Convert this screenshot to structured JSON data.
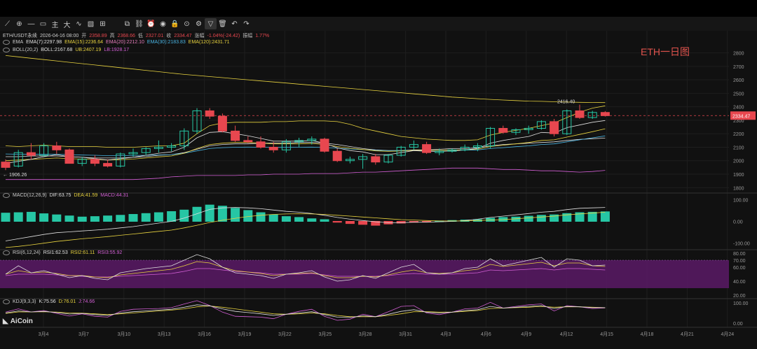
{
  "toolbar": {
    "icons": [
      "draw-line-icon",
      "cursor-icon",
      "horizontal-line-icon",
      "rectangle-icon",
      "text-icon",
      "fibonacci-icon",
      "pattern-icon",
      "brush-icon",
      "measure-icon",
      "copy-icon",
      "link-icon",
      "alert-icon",
      "eye-icon",
      "lock-icon",
      "magnet-icon",
      "settings-icon",
      "filter-icon",
      "trash-icon",
      "undo-icon",
      "redo-icon"
    ],
    "glyphs": [
      "⟋",
      "⊕",
      "—",
      "▭",
      "主",
      "大",
      "∿",
      "▧",
      "⊞",
      "⧉",
      "⛓",
      "⏰",
      "◉",
      "🔒",
      "⊙",
      "⚙",
      "▽",
      "🗑",
      "↶",
      "↷"
    ]
  },
  "colors": {
    "up": "#26c6a4",
    "down": "#e8474f",
    "ema7": "#e0e0e0",
    "ema15": "#e8d33f",
    "ema20": "#e67dbb",
    "ema30": "#4ab5e3",
    "ema120": "#e8d33f",
    "boll": "#e0e0e0",
    "ub": "#e8d33f",
    "lb": "#d35fd5",
    "dif": "#e0e0e0",
    "dea": "#e8d33f",
    "rsi1": "#e0e0e0",
    "rsi2": "#e8d33f",
    "rsi3": "#d35fd5",
    "watermark": "#e0534d"
  },
  "header": {
    "symbol": "ETH/USDT永续",
    "date": "2026-04-16 08:00",
    "open_label": "开",
    "open": "2358.89",
    "high_label": "高",
    "high": "2368.66",
    "low_label": "低",
    "low": "2327.01",
    "close_label": "收",
    "close": "2334.47",
    "change_label": "涨幅",
    "change": "-1.04%(-24.42)",
    "amp_label": "振幅",
    "amp": "1.77%"
  },
  "ema_legend": {
    "name": "EMA",
    "ema7": "EMA(7):2297.98",
    "ema15": "EMA(15):2236.64",
    "ema20": "EMA(20):2212.10",
    "ema30": "EMA(30):2183.83",
    "ema120": "EMA(120):2431.71"
  },
  "boll_legend": {
    "name": "BOLL(20,2)",
    "boll": "BOLL:2167.68",
    "ub": "UB:2407.19",
    "lb": "LB:1928.17"
  },
  "macd_legend": {
    "name": "MACD(12,26,9)",
    "dif": "DIF:63.75",
    "dea": "DEA:41.59",
    "macd": "MACD:44.31"
  },
  "rsi_legend": {
    "name": "RSI(6,12,24)",
    "rsi1": "RSI1:62.53",
    "rsi2": "RSI2:61.11",
    "rsi3": "RSI3:55.92"
  },
  "kdj_legend": {
    "name": "KDJ(9,3,3)",
    "k": "K:75.56",
    "d": "D:76.01",
    "j": "J:74.66"
  },
  "watermark": "ETH一日图",
  "logo": "AiCoin",
  "annotations": {
    "high_label": "2416.40",
    "low_label": "1906.26",
    "current_price": "2334.47"
  },
  "chart_data": {
    "type": "candlestick",
    "price_axis": {
      "ticks": [
        1800,
        1900,
        2000,
        2100,
        2200,
        2300,
        2400,
        2500,
        2600,
        2700,
        2800
      ],
      "range": [
        1760,
        2860
      ]
    },
    "macd_axis": {
      "ticks": [
        100,
        0,
        -100
      ],
      "range": [
        -130,
        130
      ]
    },
    "rsi_axis": {
      "ticks": [
        80,
        70,
        60,
        40,
        20
      ],
      "range": [
        15,
        85
      ]
    },
    "kdj_axis": {
      "ticks": [
        100,
        0
      ],
      "range": [
        -20,
        120
      ]
    },
    "x_ticks": [
      "3月4",
      "3月7",
      "3月10",
      "3月13",
      "3月16",
      "3月19",
      "3月22",
      "3月25",
      "3月28",
      "3月31",
      "4月3",
      "4月6",
      "4月9",
      "4月12",
      "4月15",
      "4月18",
      "4月21",
      "4月24"
    ],
    "candles": [
      {
        "o": 1990,
        "h": 2010,
        "l": 1930,
        "c": 1950
      },
      {
        "o": 1960,
        "h": 2080,
        "l": 1950,
        "c": 2060
      },
      {
        "o": 2060,
        "h": 2130,
        "l": 2010,
        "c": 2040
      },
      {
        "o": 2040,
        "h": 2130,
        "l": 2030,
        "c": 2110
      },
      {
        "o": 2110,
        "h": 2140,
        "l": 2050,
        "c": 2080
      },
      {
        "o": 2080,
        "h": 2090,
        "l": 1990,
        "c": 1980
      },
      {
        "o": 1980,
        "h": 2030,
        "l": 1960,
        "c": 2010
      },
      {
        "o": 2010,
        "h": 2040,
        "l": 1960,
        "c": 1980
      },
      {
        "o": 1980,
        "h": 2010,
        "l": 1950,
        "c": 1960
      },
      {
        "o": 1960,
        "h": 2060,
        "l": 1950,
        "c": 2050
      },
      {
        "o": 2050,
        "h": 2090,
        "l": 2030,
        "c": 2060
      },
      {
        "o": 2060,
        "h": 2100,
        "l": 2040,
        "c": 2090
      },
      {
        "o": 2090,
        "h": 2150,
        "l": 2060,
        "c": 2100
      },
      {
        "o": 2100,
        "h": 2130,
        "l": 2070,
        "c": 2110
      },
      {
        "o": 2110,
        "h": 2240,
        "l": 2080,
        "c": 2220
      },
      {
        "o": 2220,
        "h": 2390,
        "l": 2200,
        "c": 2370
      },
      {
        "o": 2370,
        "h": 2390,
        "l": 2310,
        "c": 2330
      },
      {
        "o": 2330,
        "h": 2350,
        "l": 2210,
        "c": 2220
      },
      {
        "o": 2220,
        "h": 2260,
        "l": 2140,
        "c": 2150
      },
      {
        "o": 2150,
        "h": 2180,
        "l": 2130,
        "c": 2140
      },
      {
        "o": 2140,
        "h": 2180,
        "l": 2090,
        "c": 2100
      },
      {
        "o": 2100,
        "h": 2140,
        "l": 2060,
        "c": 2080
      },
      {
        "o": 2080,
        "h": 2160,
        "l": 2060,
        "c": 2140
      },
      {
        "o": 2140,
        "h": 2170,
        "l": 2100,
        "c": 2150
      },
      {
        "o": 2150,
        "h": 2180,
        "l": 2120,
        "c": 2160
      },
      {
        "o": 2160,
        "h": 2170,
        "l": 2060,
        "c": 2070
      },
      {
        "o": 2070,
        "h": 2090,
        "l": 1990,
        "c": 2000
      },
      {
        "o": 2000,
        "h": 2030,
        "l": 1980,
        "c": 2010
      },
      {
        "o": 2010,
        "h": 2050,
        "l": 1940,
        "c": 2030
      },
      {
        "o": 2030,
        "h": 2050,
        "l": 1970,
        "c": 1990
      },
      {
        "o": 1990,
        "h": 2050,
        "l": 1980,
        "c": 2040
      },
      {
        "o": 2040,
        "h": 2110,
        "l": 2030,
        "c": 2100
      },
      {
        "o": 2100,
        "h": 2150,
        "l": 2080,
        "c": 2120
      },
      {
        "o": 2120,
        "h": 2140,
        "l": 2050,
        "c": 2060
      },
      {
        "o": 2060,
        "h": 2090,
        "l": 2040,
        "c": 2070
      },
      {
        "o": 2070,
        "h": 2090,
        "l": 2060,
        "c": 2080
      },
      {
        "o": 2080,
        "h": 2120,
        "l": 2070,
        "c": 2100
      },
      {
        "o": 2100,
        "h": 2130,
        "l": 2070,
        "c": 2110
      },
      {
        "o": 2110,
        "h": 2250,
        "l": 2090,
        "c": 2240
      },
      {
        "o": 2240,
        "h": 2260,
        "l": 2200,
        "c": 2210
      },
      {
        "o": 2210,
        "h": 2240,
        "l": 2190,
        "c": 2230
      },
      {
        "o": 2230,
        "h": 2260,
        "l": 2200,
        "c": 2240
      },
      {
        "o": 2240,
        "h": 2300,
        "l": 2230,
        "c": 2290
      },
      {
        "o": 2290,
        "h": 2310,
        "l": 2180,
        "c": 2200
      },
      {
        "o": 2200,
        "h": 2380,
        "l": 2190,
        "c": 2370
      },
      {
        "o": 2370,
        "h": 2416,
        "l": 2310,
        "c": 2320
      },
      {
        "o": 2320,
        "h": 2370,
        "l": 2310,
        "c": 2358
      },
      {
        "o": 2358,
        "h": 2368,
        "l": 2327,
        "c": 2334
      }
    ],
    "ub": [
      2110,
      2105,
      2110,
      2115,
      2110,
      2105,
      2105,
      2105,
      2100,
      2100,
      2100,
      2105,
      2110,
      2110,
      2130,
      2200,
      2260,
      2280,
      2285,
      2285,
      2285,
      2290,
      2290,
      2295,
      2295,
      2295,
      2290,
      2270,
      2240,
      2220,
      2200,
      2180,
      2170,
      2160,
      2155,
      2150,
      2150,
      2155,
      2190,
      2210,
      2225,
      2240,
      2260,
      2280,
      2320,
      2360,
      2390,
      2407
    ],
    "boll": [
      2030,
      2030,
      2035,
      2035,
      2035,
      2030,
      2025,
      2020,
      2020,
      2020,
      2025,
      2030,
      2040,
      2045,
      2060,
      2085,
      2110,
      2120,
      2125,
      2125,
      2130,
      2130,
      2130,
      2135,
      2135,
      2130,
      2120,
      2105,
      2090,
      2080,
      2075,
      2075,
      2080,
      2080,
      2085,
      2090,
      2090,
      2095,
      2110,
      2120,
      2125,
      2130,
      2135,
      2140,
      2150,
      2158,
      2163,
      2168
    ],
    "lb": [
      1860,
      1860,
      1860,
      1860,
      1860,
      1860,
      1860,
      1860,
      1860,
      1860,
      1860,
      1865,
      1870,
      1880,
      1885,
      1890,
      1890,
      1890,
      1890,
      1895,
      1895,
      1900,
      1900,
      1900,
      1905,
      1905,
      1905,
      1910,
      1915,
      1915,
      1920,
      1925,
      1930,
      1935,
      1940,
      1945,
      1945,
      1945,
      1940,
      1935,
      1935,
      1930,
      1925,
      1925,
      1920,
      1915,
      1920,
      1928
    ],
    "ema7": [
      1980,
      1995,
      2010,
      2030,
      2045,
      2030,
      2025,
      2015,
      2005,
      2015,
      2025,
      2040,
      2055,
      2065,
      2100,
      2170,
      2210,
      2215,
      2200,
      2185,
      2165,
      2145,
      2145,
      2145,
      2150,
      2130,
      2095,
      2075,
      2065,
      2045,
      2045,
      2060,
      2075,
      2070,
      2070,
      2072,
      2080,
      2090,
      2130,
      2150,
      2165,
      2180,
      2210,
      2205,
      2245,
      2265,
      2285,
      2298
    ],
    "ema15": [
      2000,
      2005,
      2010,
      2015,
      2020,
      2015,
      2012,
      2010,
      2005,
      2008,
      2012,
      2020,
      2028,
      2035,
      2055,
      2090,
      2120,
      2130,
      2135,
      2135,
      2130,
      2125,
      2125,
      2125,
      2128,
      2120,
      2105,
      2092,
      2083,
      2073,
      2070,
      2072,
      2077,
      2077,
      2077,
      2078,
      2081,
      2085,
      2105,
      2115,
      2125,
      2135,
      2150,
      2155,
      2175,
      2195,
      2215,
      2237
    ],
    "ema30": [
      2050,
      2048,
      2047,
      2047,
      2047,
      2045,
      2042,
      2040,
      2037,
      2037,
      2038,
      2040,
      2043,
      2045,
      2055,
      2073,
      2090,
      2097,
      2100,
      2101,
      2100,
      2099,
      2099,
      2100,
      2101,
      2098,
      2092,
      2087,
      2082,
      2077,
      2075,
      2075,
      2077,
      2077,
      2077,
      2077,
      2078,
      2080,
      2090,
      2097,
      2104,
      2110,
      2120,
      2125,
      2140,
      2155,
      2170,
      2184
    ],
    "ema120": [
      2780,
      2770,
      2760,
      2750,
      2740,
      2730,
      2720,
      2710,
      2700,
      2690,
      2680,
      2670,
      2660,
      2650,
      2640,
      2632,
      2624,
      2616,
      2608,
      2600,
      2592,
      2584,
      2576,
      2568,
      2560,
      2552,
      2544,
      2536,
      2528,
      2520,
      2512,
      2504,
      2496,
      2488,
      2480,
      2472,
      2466,
      2460,
      2455,
      2450,
      2446,
      2442,
      2440,
      2437,
      2435,
      2433,
      2432,
      2431
    ],
    "macd_hist": [
      38,
      40,
      42,
      35,
      30,
      25,
      20,
      22,
      25,
      28,
      32,
      36,
      40,
      45,
      52,
      65,
      75,
      70,
      60,
      50,
      40,
      30,
      22,
      18,
      12,
      8,
      -4,
      -10,
      -14,
      -18,
      -12,
      -8,
      -4,
      -2,
      2,
      4,
      6,
      8,
      14,
      18,
      20,
      24,
      28,
      30,
      36,
      40,
      42,
      44
    ],
    "dif": [
      -90,
      -80,
      -70,
      -60,
      -52,
      -48,
      -44,
      -40,
      -36,
      -30,
      -24,
      -16,
      -8,
      0,
      15,
      35,
      55,
      62,
      64,
      62,
      58,
      52,
      46,
      42,
      36,
      28,
      18,
      10,
      4,
      -2,
      -6,
      -6,
      -4,
      -4,
      -2,
      0,
      4,
      10,
      18,
      24,
      30,
      36,
      42,
      46,
      54,
      60,
      62,
      64
    ],
    "dea": [
      -120,
      -115,
      -108,
      -100,
      -92,
      -86,
      -80,
      -75,
      -70,
      -64,
      -58,
      -52,
      -46,
      -40,
      -30,
      -18,
      -5,
      5,
      14,
      22,
      28,
      32,
      34,
      35,
      34,
      32,
      28,
      24,
      20,
      16,
      12,
      8,
      6,
      4,
      2,
      2,
      2,
      4,
      6,
      8,
      12,
      16,
      20,
      24,
      30,
      34,
      38,
      42
    ],
    "rsi1": [
      50,
      62,
      52,
      55,
      50,
      45,
      48,
      44,
      42,
      52,
      55,
      58,
      60,
      62,
      70,
      78,
      72,
      60,
      52,
      50,
      48,
      44,
      50,
      52,
      55,
      46,
      40,
      42,
      48,
      44,
      52,
      60,
      64,
      52,
      50,
      52,
      58,
      60,
      72,
      62,
      66,
      70,
      74,
      60,
      72,
      70,
      62,
      63
    ],
    "rsi2": [
      50,
      55,
      52,
      53,
      51,
      48,
      48,
      46,
      45,
      49,
      51,
      53,
      55,
      57,
      62,
      68,
      66,
      60,
      55,
      53,
      51,
      48,
      50,
      51,
      52,
      48,
      45,
      45,
      47,
      46,
      49,
      53,
      56,
      52,
      51,
      52,
      55,
      57,
      64,
      61,
      63,
      65,
      67,
      62,
      66,
      66,
      62,
      61
    ],
    "rsi3": [
      48,
      50,
      50,
      50,
      49,
      48,
      47,
      46,
      46,
      47,
      48,
      49,
      50,
      51,
      54,
      58,
      58,
      56,
      54,
      53,
      52,
      50,
      50,
      50,
      51,
      49,
      47,
      47,
      47,
      47,
      48,
      50,
      51,
      50,
      50,
      50,
      51,
      52,
      56,
      55,
      56,
      57,
      58,
      56,
      58,
      58,
      57,
      56
    ],
    "k": [
      50,
      60,
      55,
      58,
      52,
      45,
      48,
      42,
      38,
      50,
      56,
      60,
      64,
      68,
      78,
      90,
      85,
      70,
      58,
      52,
      46,
      38,
      44,
      50,
      56,
      42,
      30,
      28,
      36,
      32,
      44,
      58,
      66,
      54,
      50,
      54,
      62,
      66,
      82,
      74,
      78,
      82,
      86,
      72,
      82,
      80,
      76,
      76
    ],
    "d": [
      48,
      55,
      55,
      56,
      54,
      50,
      49,
      46,
      42,
      46,
      50,
      55,
      60,
      64,
      70,
      80,
      84,
      78,
      70,
      62,
      54,
      46,
      44,
      46,
      50,
      46,
      38,
      32,
      32,
      32,
      38,
      46,
      56,
      56,
      54,
      54,
      58,
      62,
      72,
      74,
      76,
      78,
      82,
      78,
      80,
      80,
      78,
      76
    ],
    "j": [
      54,
      70,
      55,
      62,
      48,
      35,
      46,
      34,
      30,
      58,
      68,
      70,
      72,
      76,
      94,
      110,
      87,
      54,
      34,
      32,
      30,
      22,
      44,
      58,
      68,
      34,
      14,
      20,
      44,
      32,
      56,
      82,
      86,
      50,
      42,
      54,
      70,
      74,
      102,
      74,
      82,
      90,
      94,
      60,
      86,
      80,
      72,
      75
    ]
  }
}
